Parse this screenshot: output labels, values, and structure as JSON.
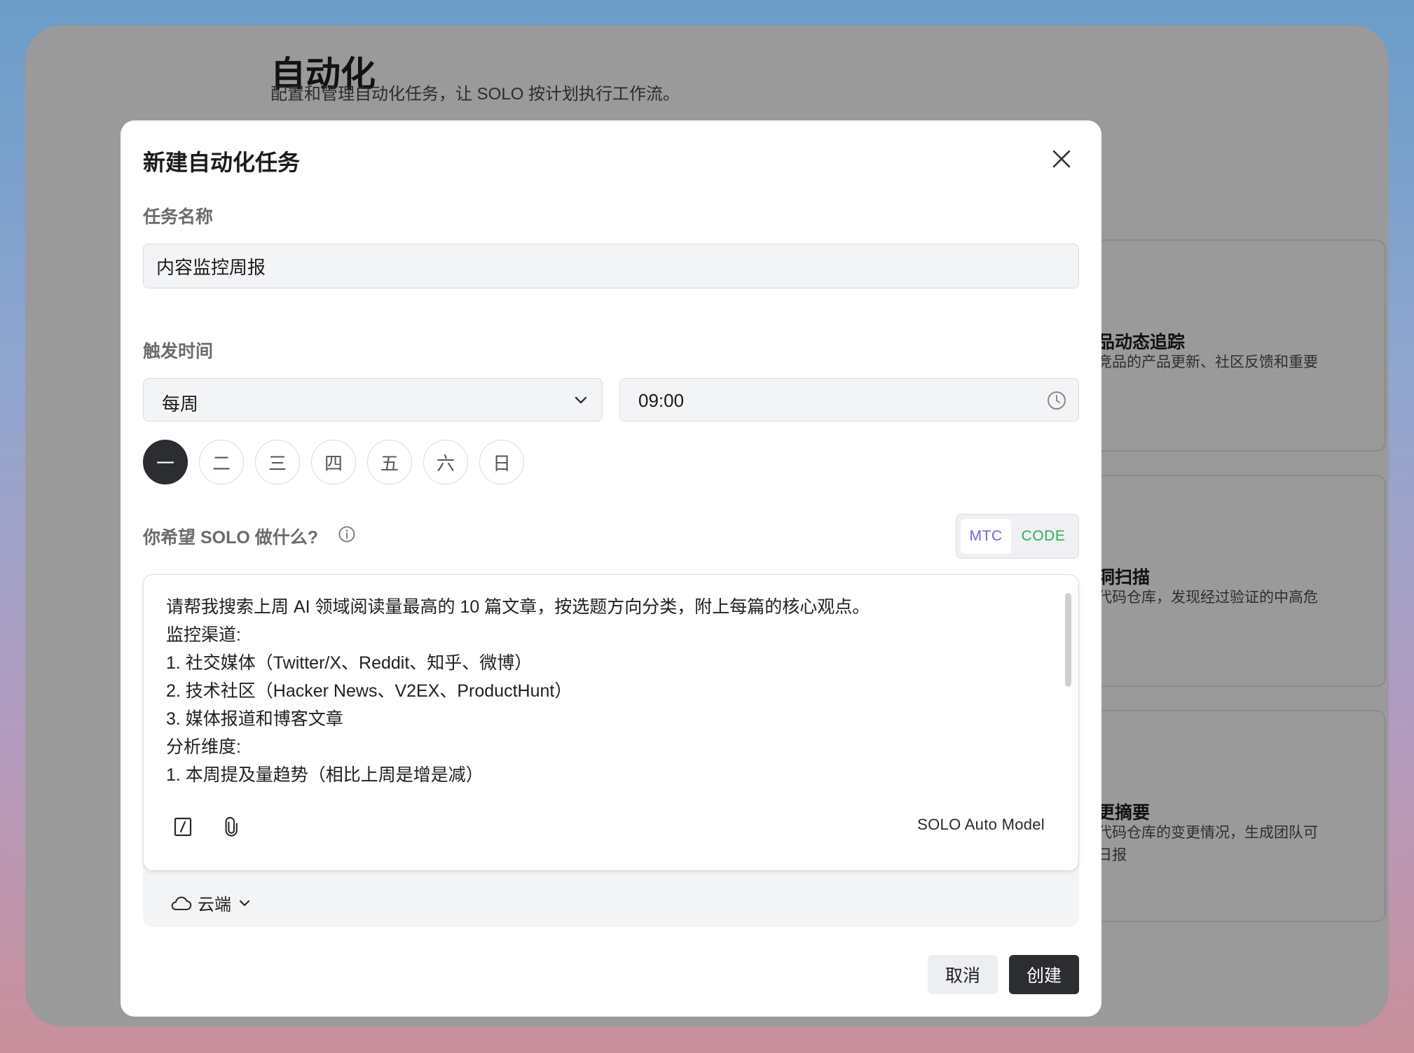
{
  "page": {
    "title": "自动化",
    "subtitle": "配置和管理自动化任务，让 SOLO 按计划执行工作流。"
  },
  "background_cards": [
    {
      "title": "品动态追踪",
      "desc": "竞品的产品更新、社区反馈和重要"
    },
    {
      "title": "洞扫描",
      "desc": "代码仓库，发现经过验证的中高危"
    },
    {
      "title": "更摘要",
      "desc": "代码仓库的变更情况，生成团队可日报"
    }
  ],
  "modal": {
    "title": "新建自动化任务",
    "task_name_label": "任务名称",
    "task_name_value": "内容监控周报",
    "trigger_label": "触发时间",
    "frequency_value": "每周",
    "time_value": "09:00",
    "days": [
      "一",
      "二",
      "三",
      "四",
      "五",
      "六",
      "日"
    ],
    "active_day": "一",
    "prompt_label": "你希望 SOLO 做什么?",
    "modes": {
      "mtc": "MTC",
      "code": "CODE"
    },
    "prompt_lines": [
      "请帮我搜索上周 AI 领域阅读量最高的 10 篇文章，按选题方向分类，附上每篇的核心观点。",
      "监控渠道:",
      "1. 社交媒体（Twitter/X、Reddit、知乎、微博）",
      "2. 技术社区（Hacker News、V2EX、ProductHunt）",
      "3. 媒体报道和博客文章",
      "分析维度:",
      "1. 本周提及量趋势（相比上周是增是减）"
    ],
    "model_label": "SOLO Auto Model",
    "env_label": "云端",
    "cancel_label": "取消",
    "create_label": "创建"
  },
  "colors": {
    "accent_dark": "#2b2d31",
    "mtc": "#7a5cf0",
    "code": "#2fae55"
  },
  "icons": [
    "close-icon",
    "chevron-down-icon",
    "clock-icon",
    "info-icon",
    "slash-command-icon",
    "paperclip-icon",
    "cloud-icon"
  ]
}
